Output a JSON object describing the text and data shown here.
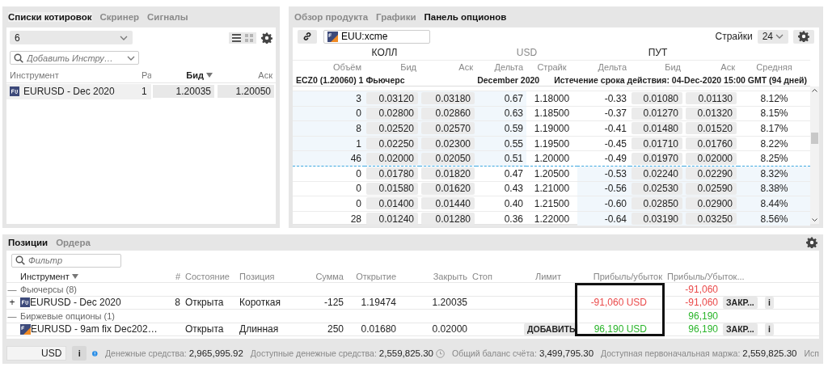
{
  "watchlist": {
    "tabs": [
      {
        "label": "Списки котировок",
        "selected": true
      },
      {
        "label": "Скринер",
        "selected": false
      },
      {
        "label": "Сигналы",
        "selected": false
      }
    ],
    "list_select": {
      "value": "6"
    },
    "view_modes": [
      {
        "kind": "list",
        "selected": true
      },
      {
        "kind": "grid",
        "selected": false
      }
    ],
    "search": {
      "placeholder": "Добавить Инстру…"
    },
    "columns": [
      {
        "label": "Инструмент",
        "sorted": false
      },
      {
        "label": "Ра",
        "sorted": false
      },
      {
        "label": "Бид",
        "sorted": true
      },
      {
        "label": "Аск",
        "sorted": false
      }
    ],
    "rows": [
      {
        "instrument": "EURUSD - Dec 2020",
        "column_2": "1",
        "bid": "1.20035",
        "ask": "1.20050",
        "selected": true
      }
    ]
  },
  "options": {
    "tabs": [
      {
        "label": "Обзор продукта",
        "selected": false
      },
      {
        "label": "Графики",
        "selected": false
      },
      {
        "label": "Панель опционов",
        "selected": true
      }
    ],
    "symbol": {
      "value": "EUU:xcme"
    },
    "strikes_label": "Страйки",
    "strikes_select": {
      "value": "24"
    },
    "sides": [
      "КОЛЛ",
      "USD",
      "ПУТ"
    ],
    "columns": [
      "Объём",
      "Бид",
      "Аск",
      "Дельта",
      "Страйк",
      "Дельта",
      "Бид",
      "Аск",
      "Средняя"
    ],
    "info": {
      "future": "ECZ0 (1.20060) 1 Фьючерс",
      "month": "December 2020",
      "expiry": "Истечение срока действия: 04-Dec-2020 15:00 GMT (94 дней)"
    },
    "rows": [
      {
        "volume": "3",
        "call_bid": "0.03120",
        "call_ask": "0.03180",
        "call_delta": "0.67",
        "strike": "1.18000",
        "put_delta": "-0.33",
        "put_bid": "0.01080",
        "put_ask": "0.01130",
        "mid": "8.12%",
        "kind": "call_itm"
      },
      {
        "volume": "0",
        "call_bid": "0.02800",
        "call_ask": "0.02860",
        "call_delta": "0.63",
        "strike": "1.18500",
        "put_delta": "-0.37",
        "put_bid": "0.01270",
        "put_ask": "0.01320",
        "mid": "8.15%",
        "kind": "call_itm"
      },
      {
        "volume": "8",
        "call_bid": "0.02520",
        "call_ask": "0.02570",
        "call_delta": "0.59",
        "strike": "1.19000",
        "put_delta": "-0.41",
        "put_bid": "0.01480",
        "put_ask": "0.01520",
        "mid": "8.17%",
        "kind": "call_itm"
      },
      {
        "volume": "1",
        "call_bid": "0.02250",
        "call_ask": "0.02300",
        "call_delta": "0.55",
        "strike": "1.19500",
        "put_delta": "-0.45",
        "put_bid": "0.01710",
        "put_ask": "0.01760",
        "mid": "8.22%",
        "kind": "call_itm"
      },
      {
        "volume": "46",
        "call_bid": "0.02000",
        "call_ask": "0.02050",
        "call_delta": "0.51",
        "strike": "1.20000",
        "put_delta": "-0.49",
        "put_bid": "0.01970",
        "put_ask": "0.02000",
        "mid": "8.25%",
        "kind": "call_itm"
      },
      {
        "volume": "0",
        "call_bid": "0.01780",
        "call_ask": "0.01820",
        "call_delta": "0.47",
        "strike": "1.20500",
        "put_delta": "-0.53",
        "put_bid": "0.02240",
        "put_ask": "0.02290",
        "mid": "8.32%",
        "kind": "put_itm"
      },
      {
        "volume": "0",
        "call_bid": "0.01580",
        "call_ask": "0.01620",
        "call_delta": "0.43",
        "strike": "1.21000",
        "put_delta": "-0.56",
        "put_bid": "0.02530",
        "put_ask": "0.02590",
        "mid": "8.38%",
        "kind": "put_itm"
      },
      {
        "volume": "0",
        "call_bid": "0.01400",
        "call_ask": "0.01440",
        "call_delta": "0.40",
        "strike": "1.21500",
        "put_delta": "-0.60",
        "put_bid": "0.02850",
        "put_ask": "0.02900",
        "mid": "8.44%",
        "kind": "put_itm"
      },
      {
        "volume": "28",
        "call_bid": "0.01240",
        "call_ask": "0.01280",
        "call_delta": "0.36",
        "strike": "1.22000",
        "put_delta": "-0.64",
        "put_bid": "0.03190",
        "put_ask": "0.03250",
        "mid": "8.56%",
        "kind": "put_itm"
      }
    ]
  },
  "positions": {
    "tabs": [
      {
        "label": "Позиции",
        "selected": true
      },
      {
        "label": "Ордера",
        "selected": false
      }
    ],
    "filter": {
      "placeholder": "Фильтр"
    },
    "columns": [
      {
        "label": "Инструмент",
        "sorted": true,
        "highlighted": false
      },
      {
        "label": "#",
        "sorted": false,
        "highlighted": false
      },
      {
        "label": "Состояние",
        "sorted": false,
        "highlighted": false
      },
      {
        "label": "Позиция",
        "sorted": false,
        "highlighted": false
      },
      {
        "label": "Сумма",
        "sorted": false,
        "highlighted": false
      },
      {
        "label": "Открытие",
        "sorted": false,
        "highlighted": false
      },
      {
        "label": "Закрыть",
        "sorted": false,
        "highlighted": false
      },
      {
        "label": "Стоп",
        "sorted": false,
        "highlighted": false
      },
      {
        "label": "Лимит",
        "sorted": false,
        "highlighted": false
      },
      {
        "label": "Прибыль/убыток",
        "sorted": false,
        "highlighted": true
      },
      {
        "label": "Прибыль/Убыток...",
        "sorted": false,
        "highlighted": false
      }
    ],
    "rows": [
      {
        "kind": "group",
        "toggle": "—",
        "label": "Фьючерсы (8)",
        "pnl_total": "-91,060",
        "color": "#ea4a4a"
      },
      {
        "kind": "future",
        "toggle": "+",
        "instrument": "EURUSD - Dec 2020",
        "count": "8",
        "state": "Открыта",
        "side": "Короткая",
        "amount": "-125",
        "open": "1.19474",
        "close": "1.20035",
        "pnl": "-91,060 USD",
        "pnl_short": "-91,060",
        "color": "#ea4a4a",
        "close_button": "ЗАКР...",
        "info_button": "i"
      },
      {
        "kind": "group",
        "toggle": "—",
        "label": "Биржевые опционы (1)",
        "pnl_total": "96,190",
        "color": "#2bb52b"
      },
      {
        "kind": "option",
        "instrument": "EURUSD - 9am fix Dec202…",
        "state": "Открыта",
        "side": "Длинная",
        "amount": "250",
        "open": "0.01680",
        "close": "0.02000",
        "limit_button": "ДОБАВИТЬ",
        "pnl": "96,190 USD",
        "pnl_short": "96,190",
        "color": "#2bb52b",
        "close_button": "ЗАКР...",
        "info_button": "i"
      }
    ]
  },
  "status_bar": {
    "account": {
      "currency": "USD"
    },
    "info_button": "i",
    "metrics": [
      {
        "label": "Денежные средства:",
        "value": "2,965,995.92",
        "hint": false
      },
      {
        "label": "Доступные денежные средства:",
        "value": "2,559,825.30",
        "hint": true
      },
      {
        "label": "Общий баланс счёта:",
        "value": "3,499,795.30",
        "hint": false
      },
      {
        "label": "Доступная первоначальная маржа:",
        "value": "2,559,825.30",
        "hint": false
      },
      {
        "label": "Исп",
        "hint": false
      }
    ]
  }
}
